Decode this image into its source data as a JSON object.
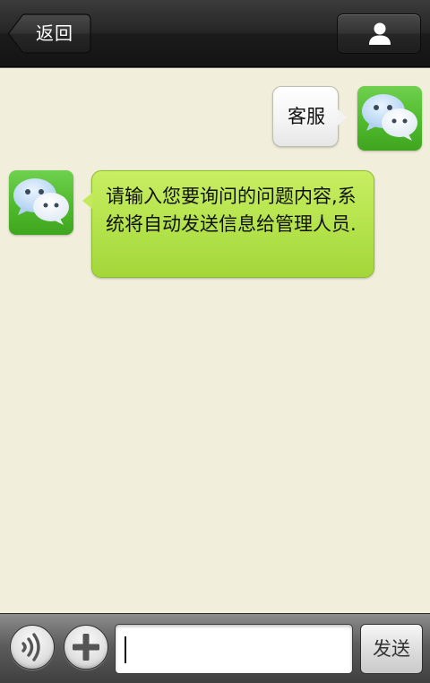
{
  "header": {
    "back_label": "返回",
    "profile_icon": "person-icon"
  },
  "conversation": {
    "messages": [
      {
        "direction": "outgoing",
        "text": "客服",
        "avatar_icon": "chat-bubbles-icon"
      },
      {
        "direction": "incoming",
        "text": "请输入您要询问的问题内容,系统将自动发送信息给管理人员.",
        "avatar_icon": "chat-bubbles-icon"
      }
    ]
  },
  "input_bar": {
    "voice_icon": "voice-icon",
    "plus_icon": "plus-icon",
    "input_value": "",
    "send_label": "发送"
  },
  "colors": {
    "background": "#f1eedb",
    "incoming_bubble": "#b3e24a",
    "outgoing_bubble": "#f3f3f3",
    "avatar": "#4fba2c",
    "topbar": "#262626"
  }
}
